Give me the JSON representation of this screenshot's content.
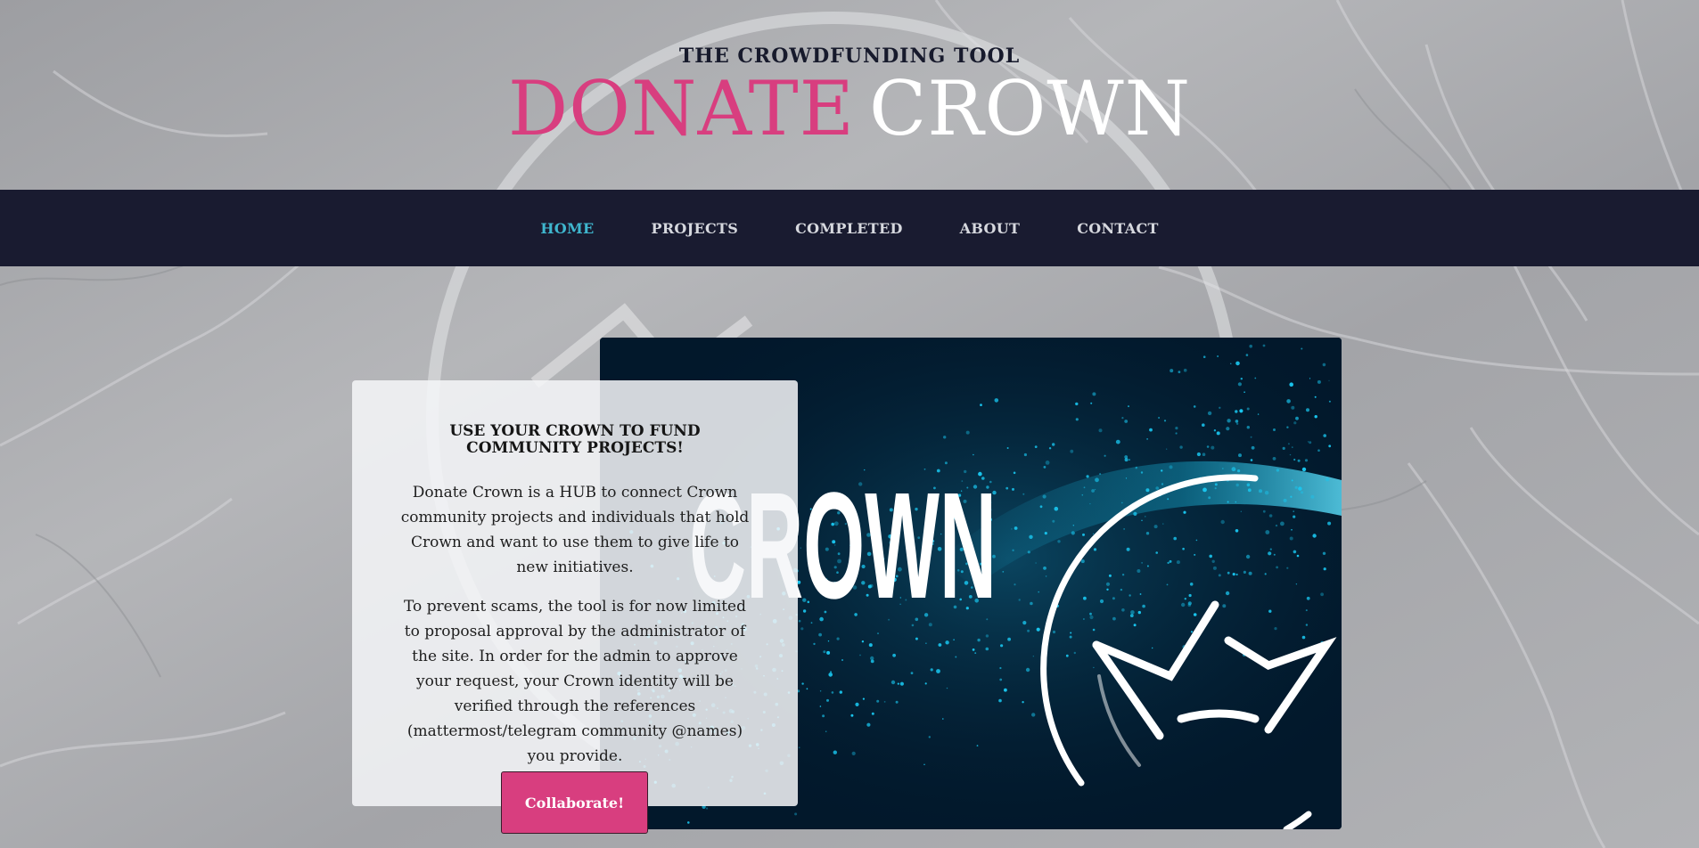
{
  "header": {
    "tagline": "THE CROWDFUNDING TOOL",
    "brand_primary": "DONATE",
    "brand_secondary": "CROWN"
  },
  "nav": {
    "items": [
      {
        "label": "HOME",
        "active": true
      },
      {
        "label": "PROJECTS",
        "active": false
      },
      {
        "label": "COMPLETED",
        "active": false
      },
      {
        "label": "ABOUT",
        "active": false
      },
      {
        "label": "CONTACT",
        "active": false
      }
    ]
  },
  "hero": {
    "image_text": "CROWN",
    "title": "USE YOUR CROWN TO FUND COMMUNITY PROJECTS!",
    "paragraphs": [
      "Donate Crown is a HUB to connect Crown community projects and individuals that hold Crown and want to use them to give life to new initiatives.",
      "To prevent scams, the tool is for now limited to proposal approval by the administrator of the site. In order for the admin to approve your request, your Crown identity will be verified through the references (mattermost/telegram community @names) you provide."
    ],
    "button_label": "Collaborate!"
  },
  "colors": {
    "accent_pink": "#d83e7f",
    "nav_background": "#191b30",
    "nav_active": "#3fb7cf",
    "hero_background": "#02182b",
    "particle_cyan": "#19c6ef"
  },
  "icons": {
    "hero_logo": "crown-logo-icon",
    "background_ring": "crown-ring-decoration"
  }
}
